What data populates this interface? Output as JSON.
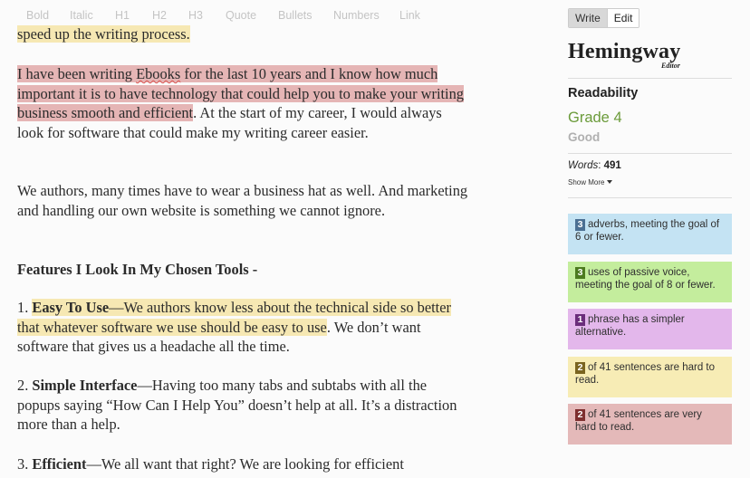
{
  "toolbar": {
    "bold": "Bold",
    "italic": "Italic",
    "h1": "H1",
    "h2": "H2",
    "h3": "H3",
    "quote": "Quote",
    "bullets": "Bullets",
    "numbers": "Numbers",
    "link": "Link"
  },
  "editor": {
    "p0": "speed up the writing process.",
    "p1": {
      "hl_a": "I have been writing ",
      "spell": "Ebooks",
      "hl_b": " for the last 10 years and I know how much important it is to have technology that could help you to make your writing business smooth and efficient",
      "rest": ". At the start of my career, I would always look for software that could make my writing career easier."
    },
    "p2": "We authors, many times have to wear a business hat as well. And marketing and handling our own website is something we cannot ignore.",
    "heading": "Features I Look In My Chosen Tools -",
    "item1": {
      "num": "1. ",
      "bold": "Easy To Use",
      "hl": "—We authors know less about the technical side so better that whatever software we use should be easy to use",
      "rest": ". We don’t want software that gives us a headache all the time."
    },
    "item2": {
      "num": "2. ",
      "bold": "Simple Interface",
      "rest": "—Having too many tabs and subtabs with all the popups saying “How Can I Help You” doesn’t help at all. It’s a distraction more than a help."
    },
    "item3": {
      "num": "3. ",
      "bold": "Efficient",
      "rest": "—We all want that right? We are looking for efficient"
    }
  },
  "sidebar": {
    "mode_write": "Write",
    "mode_edit": "Edit",
    "logo_main": "Hemingway",
    "logo_sub": "Editor",
    "readability_label": "Readability",
    "grade": "Grade 4",
    "grade_desc": "Good",
    "words_label": "Words",
    "words_count": "491",
    "show_more": "Show More"
  },
  "cards": {
    "adverbs": {
      "count": "3",
      "text": "adverbs, meeting the goal of 6 or fewer."
    },
    "passive": {
      "count": "3",
      "text": "uses of passive voice, meeting the goal of 8 or fewer."
    },
    "simpler": {
      "count": "1",
      "text": "phrase has a simpler alternative."
    },
    "hard": {
      "count": "2",
      "text": "of 41 sentences are hard to read."
    },
    "very_hard": {
      "count": "2",
      "text": "of 41 sentences are very hard to read."
    }
  },
  "colors": {
    "grade_green": "#6b9b3a",
    "very_hard_highlight": "#e5b5b5",
    "hard_highlight": "#f6e8b3",
    "adverb_card": "#c4e3f3",
    "passive_card": "#c4ed9d",
    "simpler_card": "#e3b7eb",
    "hard_card": "#f7ecb5",
    "very_hard_card": "#e4b9b9"
  },
  "icons": {
    "show_more": "caret-down-icon"
  }
}
